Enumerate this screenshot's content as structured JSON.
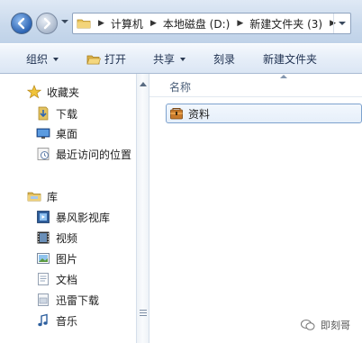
{
  "address_bar": {
    "breadcrumbs": [
      "计算机",
      "本地磁盘 (D:)",
      "新建文件夹 (3)"
    ]
  },
  "toolbar": {
    "organize_label": "组织",
    "open_label": "打开",
    "share_label": "共享",
    "burn_label": "刻录",
    "new_folder_label": "新建文件夹"
  },
  "navigation": {
    "favorites_label": "收藏夹",
    "favorites": [
      {
        "label": "下载",
        "icon": "download-folder-icon"
      },
      {
        "label": "桌面",
        "icon": "desktop-icon"
      },
      {
        "label": "最近访问的位置",
        "icon": "recent-places-icon"
      }
    ],
    "libraries_label": "库",
    "libraries": [
      {
        "label": "暴风影视库",
        "icon": "video-library-icon"
      },
      {
        "label": "视频",
        "icon": "video-icon"
      },
      {
        "label": "图片",
        "icon": "picture-icon"
      },
      {
        "label": "文档",
        "icon": "document-icon"
      },
      {
        "label": "迅雷下载",
        "icon": "thunder-download-icon"
      },
      {
        "label": "音乐",
        "icon": "music-icon"
      }
    ]
  },
  "content": {
    "column_name": "名称",
    "items": [
      {
        "name": "资料",
        "icon": "archive-folder-icon",
        "selected": true
      }
    ]
  },
  "watermark": {
    "text": "即刻哥"
  },
  "colors": {
    "accent": "#2d64b3",
    "selection_border": "#7da2ce",
    "toolbar_text": "#1e3050"
  }
}
